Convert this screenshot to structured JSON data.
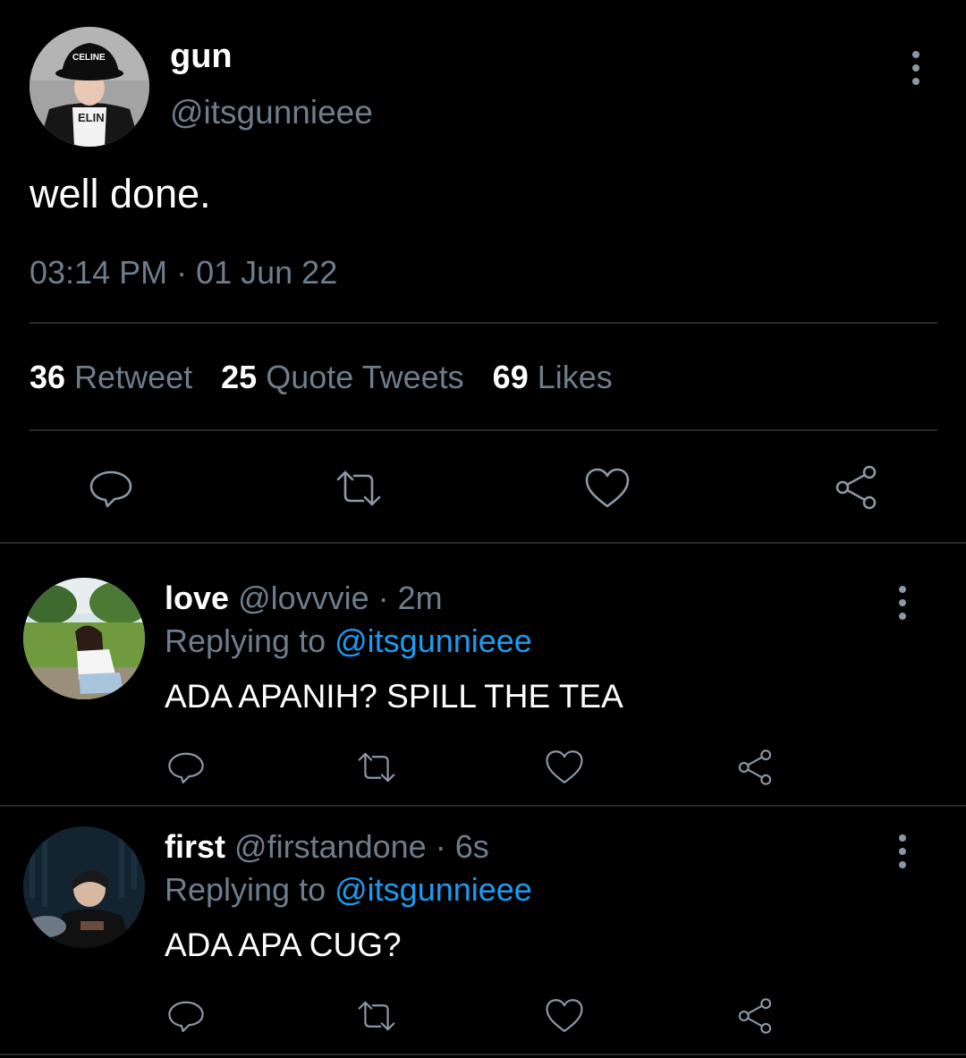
{
  "tweet": {
    "display_name": "gun",
    "handle": "@itsgunnieee",
    "text": "well done.",
    "timestamp": "03:14 PM · 01 Jun 22",
    "avatar_cap_text": "CELINE",
    "stats": {
      "retweets_count": "36",
      "retweets_label": "Retweet",
      "quotes_count": "25",
      "quotes_label": "Quote Tweets",
      "likes_count": "69",
      "likes_label": "Likes"
    }
  },
  "replies": [
    {
      "display_name": "love",
      "handle": "@lovvvie",
      "time": "· 2m",
      "replying_label": "Replying to",
      "replying_handle": "@itsgunnieee",
      "text": "ADA APANIH? SPILL THE TEA"
    },
    {
      "display_name": "first",
      "handle": "@firstandone",
      "time": "· 6s",
      "replying_label": "Replying to",
      "replying_handle": "@itsgunnieee",
      "text": "ADA APA CUG?"
    }
  ],
  "colors": {
    "background": "#000000",
    "muted_text": "#6e7d8c",
    "link": "#1d9bf0",
    "icon": "#8b98a5",
    "divider": "#262b30"
  },
  "icons": [
    "reply-icon",
    "retweet-icon",
    "like-icon",
    "share-icon",
    "more-options-icon"
  ]
}
